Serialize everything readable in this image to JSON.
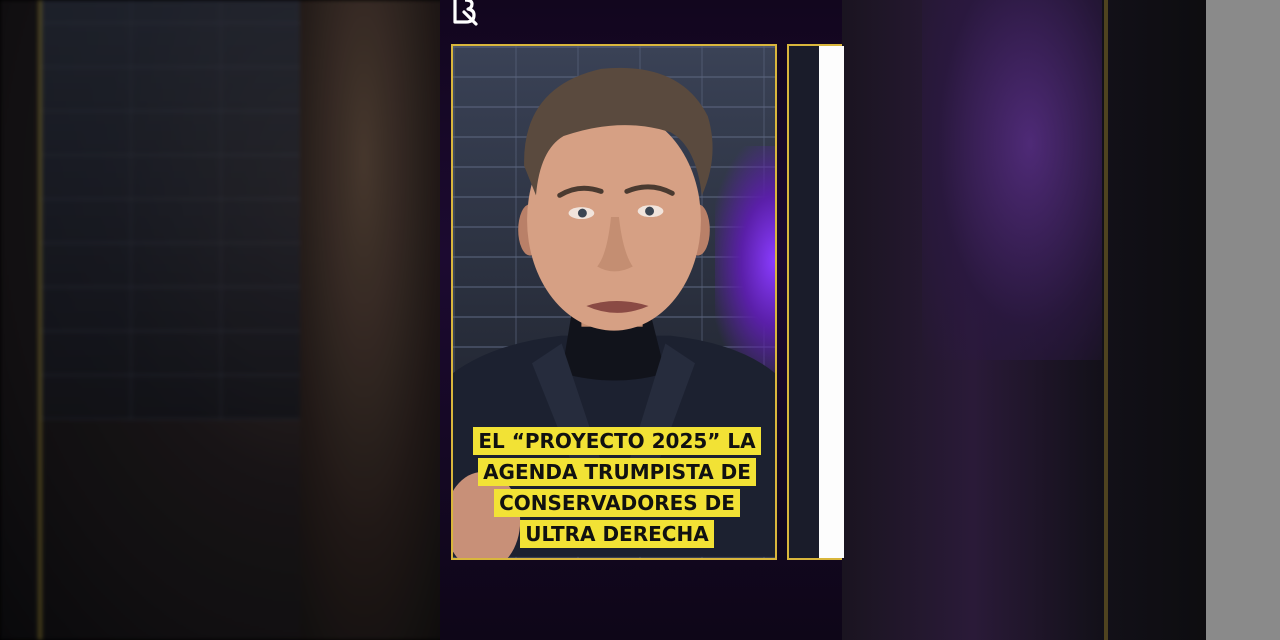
{
  "brand": {
    "logo_icon": "b-logo-icon"
  },
  "video": {
    "caption_lines": [
      "EL “PROYECTO 2025” LA",
      "AGENDA TRUMPISTA DE",
      "CONSERVADORES DE",
      "ULTRA DERECHA"
    ],
    "frame_color": "#d9b63c",
    "caption_bg": "#f2e235"
  }
}
